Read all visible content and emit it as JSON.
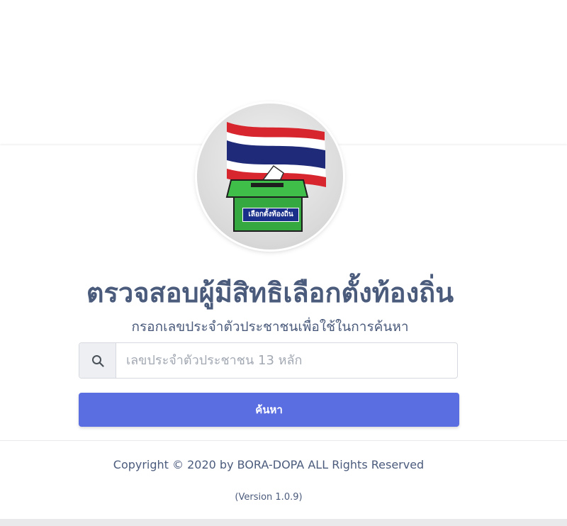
{
  "logo": {
    "box_label": "เลือกตั้งท้องถิ่น",
    "icon": "thai-flag-ballot-box-icon"
  },
  "header": {
    "title": "ตรวจสอบผู้มีสิทธิเลือกตั้งท้องถิ่น",
    "subtitle": "กรอกเลขประจำตัวประชาชนเพื่อใช้ในการค้นหา"
  },
  "search": {
    "icon": "search-icon",
    "placeholder": "เลขประจำตัวประชาชน 13 หลัก",
    "value": "",
    "button_label": "ค้นหา"
  },
  "footer": {
    "copyright": "Copyright © 2020 by BORA-DOPA ALL Rights Reserved",
    "version": "(Version 1.0.9)"
  },
  "colors": {
    "accent": "#5b6ee1",
    "text": "#4b5b7c",
    "flag_red": "#d7262e",
    "flag_blue": "#1f2a78",
    "ballot_green": "#3fbf4a"
  }
}
